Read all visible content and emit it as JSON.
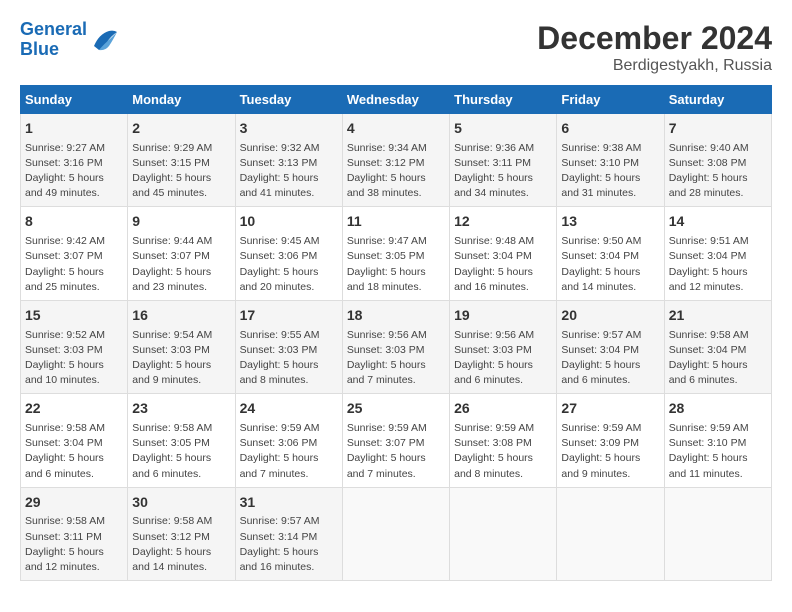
{
  "header": {
    "logo_line1": "General",
    "logo_line2": "Blue",
    "month": "December 2024",
    "location": "Berdigestyakh, Russia"
  },
  "weekdays": [
    "Sunday",
    "Monday",
    "Tuesday",
    "Wednesday",
    "Thursday",
    "Friday",
    "Saturday"
  ],
  "weeks": [
    [
      {
        "day": "1",
        "info": "Sunrise: 9:27 AM\nSunset: 3:16 PM\nDaylight: 5 hours\nand 49 minutes."
      },
      {
        "day": "2",
        "info": "Sunrise: 9:29 AM\nSunset: 3:15 PM\nDaylight: 5 hours\nand 45 minutes."
      },
      {
        "day": "3",
        "info": "Sunrise: 9:32 AM\nSunset: 3:13 PM\nDaylight: 5 hours\nand 41 minutes."
      },
      {
        "day": "4",
        "info": "Sunrise: 9:34 AM\nSunset: 3:12 PM\nDaylight: 5 hours\nand 38 minutes."
      },
      {
        "day": "5",
        "info": "Sunrise: 9:36 AM\nSunset: 3:11 PM\nDaylight: 5 hours\nand 34 minutes."
      },
      {
        "day": "6",
        "info": "Sunrise: 9:38 AM\nSunset: 3:10 PM\nDaylight: 5 hours\nand 31 minutes."
      },
      {
        "day": "7",
        "info": "Sunrise: 9:40 AM\nSunset: 3:08 PM\nDaylight: 5 hours\nand 28 minutes."
      }
    ],
    [
      {
        "day": "8",
        "info": "Sunrise: 9:42 AM\nSunset: 3:07 PM\nDaylight: 5 hours\nand 25 minutes."
      },
      {
        "day": "9",
        "info": "Sunrise: 9:44 AM\nSunset: 3:07 PM\nDaylight: 5 hours\nand 23 minutes."
      },
      {
        "day": "10",
        "info": "Sunrise: 9:45 AM\nSunset: 3:06 PM\nDaylight: 5 hours\nand 20 minutes."
      },
      {
        "day": "11",
        "info": "Sunrise: 9:47 AM\nSunset: 3:05 PM\nDaylight: 5 hours\nand 18 minutes."
      },
      {
        "day": "12",
        "info": "Sunrise: 9:48 AM\nSunset: 3:04 PM\nDaylight: 5 hours\nand 16 minutes."
      },
      {
        "day": "13",
        "info": "Sunrise: 9:50 AM\nSunset: 3:04 PM\nDaylight: 5 hours\nand 14 minutes."
      },
      {
        "day": "14",
        "info": "Sunrise: 9:51 AM\nSunset: 3:04 PM\nDaylight: 5 hours\nand 12 minutes."
      }
    ],
    [
      {
        "day": "15",
        "info": "Sunrise: 9:52 AM\nSunset: 3:03 PM\nDaylight: 5 hours\nand 10 minutes."
      },
      {
        "day": "16",
        "info": "Sunrise: 9:54 AM\nSunset: 3:03 PM\nDaylight: 5 hours\nand 9 minutes."
      },
      {
        "day": "17",
        "info": "Sunrise: 9:55 AM\nSunset: 3:03 PM\nDaylight: 5 hours\nand 8 minutes."
      },
      {
        "day": "18",
        "info": "Sunrise: 9:56 AM\nSunset: 3:03 PM\nDaylight: 5 hours\nand 7 minutes."
      },
      {
        "day": "19",
        "info": "Sunrise: 9:56 AM\nSunset: 3:03 PM\nDaylight: 5 hours\nand 6 minutes."
      },
      {
        "day": "20",
        "info": "Sunrise: 9:57 AM\nSunset: 3:04 PM\nDaylight: 5 hours\nand 6 minutes."
      },
      {
        "day": "21",
        "info": "Sunrise: 9:58 AM\nSunset: 3:04 PM\nDaylight: 5 hours\nand 6 minutes."
      }
    ],
    [
      {
        "day": "22",
        "info": "Sunrise: 9:58 AM\nSunset: 3:04 PM\nDaylight: 5 hours\nand 6 minutes."
      },
      {
        "day": "23",
        "info": "Sunrise: 9:58 AM\nSunset: 3:05 PM\nDaylight: 5 hours\nand 6 minutes."
      },
      {
        "day": "24",
        "info": "Sunrise: 9:59 AM\nSunset: 3:06 PM\nDaylight: 5 hours\nand 7 minutes."
      },
      {
        "day": "25",
        "info": "Sunrise: 9:59 AM\nSunset: 3:07 PM\nDaylight: 5 hours\nand 7 minutes."
      },
      {
        "day": "26",
        "info": "Sunrise: 9:59 AM\nSunset: 3:08 PM\nDaylight: 5 hours\nand 8 minutes."
      },
      {
        "day": "27",
        "info": "Sunrise: 9:59 AM\nSunset: 3:09 PM\nDaylight: 5 hours\nand 9 minutes."
      },
      {
        "day": "28",
        "info": "Sunrise: 9:59 AM\nSunset: 3:10 PM\nDaylight: 5 hours\nand 11 minutes."
      }
    ],
    [
      {
        "day": "29",
        "info": "Sunrise: 9:58 AM\nSunset: 3:11 PM\nDaylight: 5 hours\nand 12 minutes."
      },
      {
        "day": "30",
        "info": "Sunrise: 9:58 AM\nSunset: 3:12 PM\nDaylight: 5 hours\nand 14 minutes."
      },
      {
        "day": "31",
        "info": "Sunrise: 9:57 AM\nSunset: 3:14 PM\nDaylight: 5 hours\nand 16 minutes."
      },
      {
        "day": "",
        "info": ""
      },
      {
        "day": "",
        "info": ""
      },
      {
        "day": "",
        "info": ""
      },
      {
        "day": "",
        "info": ""
      }
    ]
  ]
}
